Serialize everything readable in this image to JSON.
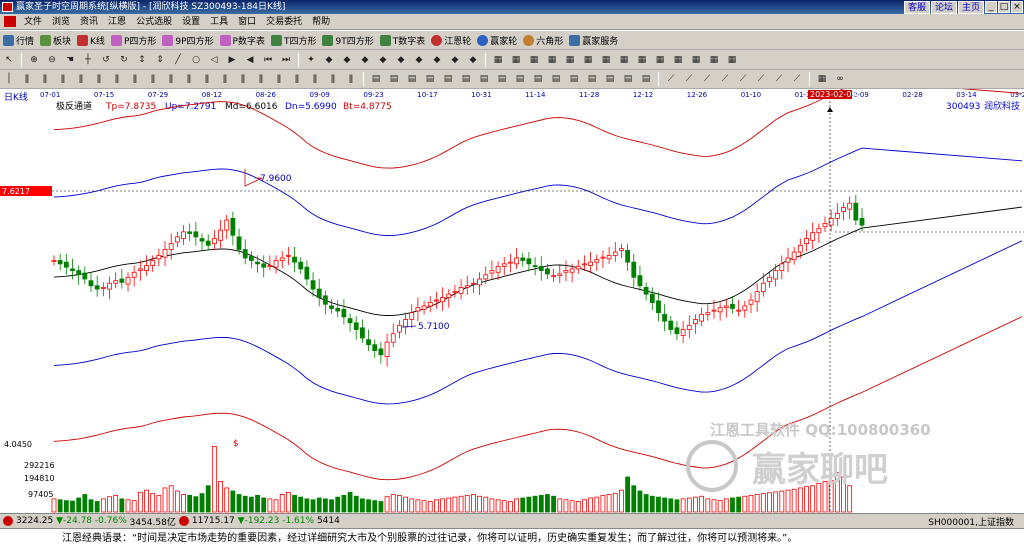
{
  "window": {
    "title": "赢家圣子时空周期系统[纵横版] - [润欣科技   SZ300493-184日K线]",
    "links": [
      "客服",
      "论坛",
      "主页"
    ],
    "controls": [
      "_",
      "□",
      "×"
    ]
  },
  "menu": [
    "文件",
    "浏览",
    "资讯",
    "江恩",
    "公式选股",
    "设置",
    "工具",
    "窗口",
    "交易委托",
    "帮助"
  ],
  "toolbar1": [
    "行情",
    "板块",
    "K线",
    "P四方形",
    "9P四方形",
    "P数字表",
    "T四方形",
    "9T四方形",
    "T数字表",
    "江恩轮",
    "赢家轮",
    "六角形",
    "赢家服务"
  ],
  "chart_label": "日K线",
  "indicator": {
    "name": "极反通道",
    "tp": "Tp=7.8735",
    "up": "Up=7.2791",
    "md": "Md=6.6016",
    "dn": "Dn=5.6990",
    "bt": "Bt=4.8775"
  },
  "stock": {
    "code": "300493",
    "name": "润欣科技"
  },
  "date_ticks": [
    "07-01",
    "07-15",
    "07-29",
    "08-12",
    "08-26",
    "09-09",
    "09-23",
    "10-17",
    "10-31",
    "11-14",
    "11-28",
    "12-12",
    "12-26",
    "01-10",
    "01-31",
    "02-09",
    "02-28",
    "03-14",
    "03-28"
  ],
  "crosshair_date": "2023-02-09",
  "current_price": "7.6217",
  "annotations": {
    "high": "7.9600",
    "low": "5.7100"
  },
  "volume_axis": [
    "4.0450",
    "292216",
    "194810",
    "97405"
  ],
  "volume_marker": "$",
  "watermark": {
    "line1": "江恩工具软件  QQ:100800360",
    "line2": "赢家聊吧"
  },
  "status": {
    "sh_index": "3224.25",
    "sh_change": "▼-24.78",
    "sh_pct": "-0.76%",
    "sh_amount": "3454.58亿",
    "sz_index": "11715.17",
    "sz_change": "▼-192.23",
    "sz_pct": "-1.61%",
    "sz_amount": "5414",
    "right": "SH000001,上证指数"
  },
  "quote": "江恩经典语录：“时间是决定市场走势的重要因素，经过详细研究大市及个别股票的过往记录，你将可以证明，历史确实重复发生；而了解过往，你将可以预测将来。”。",
  "colors": {
    "up": "#ff0000",
    "down": "#008000",
    "band_outer": "#cc0000",
    "band_inner": "#0000cc",
    "mid": "#000000",
    "price_tag": "#ff0000"
  },
  "chart_data": {
    "type": "candlestick",
    "ylim": [
      4.045,
      8.6
    ],
    "current": 7.6217,
    "high": 7.96,
    "low": 5.71,
    "closes": [
      6.92,
      6.88,
      6.84,
      6.8,
      6.75,
      6.7,
      6.62,
      6.58,
      6.6,
      6.65,
      6.68,
      6.66,
      6.72,
      6.78,
      6.82,
      6.86,
      6.92,
      6.98,
      7.05,
      7.12,
      7.2,
      7.26,
      7.24,
      7.2,
      7.15,
      7.1,
      7.18,
      7.28,
      7.4,
      7.22,
      7.05,
      6.95,
      6.92,
      6.88,
      6.84,
      6.86,
      6.92,
      6.95,
      6.98,
      6.9,
      6.82,
      6.7,
      6.58,
      6.48,
      6.4,
      6.35,
      6.32,
      6.25,
      6.18,
      6.1,
      6.0,
      5.92,
      5.85,
      5.8,
      5.95,
      6.05,
      6.15,
      6.22,
      6.3,
      6.36,
      6.38,
      6.42,
      6.45,
      6.48,
      6.52,
      6.55,
      6.6,
      6.62,
      6.65,
      6.7,
      6.75,
      6.8,
      6.85,
      6.88,
      6.9,
      6.95,
      6.92,
      6.88,
      6.85,
      6.8,
      6.76,
      6.74,
      6.76,
      6.8,
      6.82,
      6.85,
      6.88,
      6.9,
      6.93,
      6.96,
      6.98,
      7.02,
      7.06,
      6.9,
      6.72,
      6.62,
      6.52,
      6.42,
      6.3,
      6.2,
      6.1,
      6.05,
      6.1,
      6.15,
      6.22,
      6.28,
      6.3,
      6.33,
      6.36,
      6.38,
      6.35,
      6.33,
      6.38,
      6.45,
      6.55,
      6.65,
      6.72,
      6.8,
      6.88,
      6.95,
      7.02,
      7.1,
      7.18,
      7.25,
      7.3,
      7.36,
      7.42,
      7.48,
      7.55,
      7.6,
      7.4,
      7.34
    ],
    "volume": [
      30,
      28,
      26,
      25,
      32,
      40,
      28,
      24,
      30,
      35,
      38,
      30,
      28,
      26,
      45,
      50,
      42,
      38,
      55,
      60,
      48,
      40,
      38,
      35,
      42,
      60,
      150,
      70,
      55,
      48,
      40,
      36,
      34,
      38,
      32,
      30,
      28,
      40,
      45,
      38,
      34,
      30,
      28,
      32,
      30,
      28,
      34,
      38,
      45,
      36,
      30,
      28,
      26,
      24,
      35,
      40,
      38,
      34,
      30,
      28,
      26,
      24,
      28,
      30,
      32,
      34,
      36,
      38,
      40,
      36,
      34,
      30,
      28,
      26,
      24,
      30,
      32,
      34,
      36,
      38,
      40,
      36,
      30,
      28,
      26,
      24,
      28,
      32,
      34,
      38,
      40,
      42,
      50,
      80,
      60,
      48,
      40,
      36,
      34,
      32,
      30,
      28,
      30,
      32,
      34,
      36,
      30,
      28,
      26,
      30,
      32,
      34,
      36,
      38,
      40,
      42,
      44,
      46,
      48,
      50,
      52,
      55,
      58,
      60,
      65,
      70,
      72,
      90,
      80,
      60
    ]
  }
}
